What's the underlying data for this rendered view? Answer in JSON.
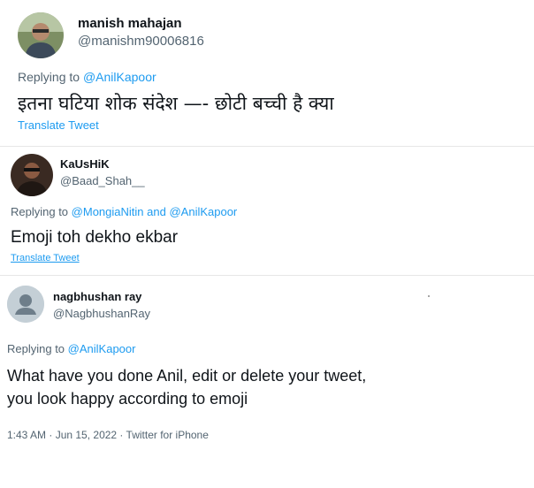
{
  "tweets": [
    {
      "avatar_icon": "user-photo-avatar",
      "name": "manish mahajan",
      "handle": "@manishm90006816",
      "replying_prefix": "Replying to",
      "mention": "@AnilKapoor",
      "text": "इतना घटिया शोक संदेश —- छोटी बच्ची है क्या",
      "translate_label": "Translate Tweet"
    },
    {
      "avatar_icon": "user-photo-avatar",
      "name": "KaUsHiK",
      "handle": "@Baad_Shah__",
      "replying_prefix": "Replying to",
      "mention_1": "@MongiaNitin",
      "joiner": "and",
      "mention_2": "@AnilKapoor",
      "text": "Emoji toh dekho ekbar",
      "translate_label": "Translate Tweet"
    },
    {
      "avatar_icon": "default-profile-avatar",
      "name": "nagbhushan ray",
      "handle": "@NagbhushanRay",
      "replying_prefix": "Replying to",
      "mention": "@AnilKapoor",
      "text_line_1": "What have you done Anil, edit or delete your tweet,",
      "text_line_2": "you look happy according to emoji",
      "timestamp": "1:43 AM · Jun 15, 2022 · Twitter for iPhone"
    }
  ],
  "colors": {
    "link": "#1d9bf0",
    "secondary_text": "#536471",
    "primary_text": "#0f1419",
    "default_avatar_bg": "#c4cfd6"
  }
}
